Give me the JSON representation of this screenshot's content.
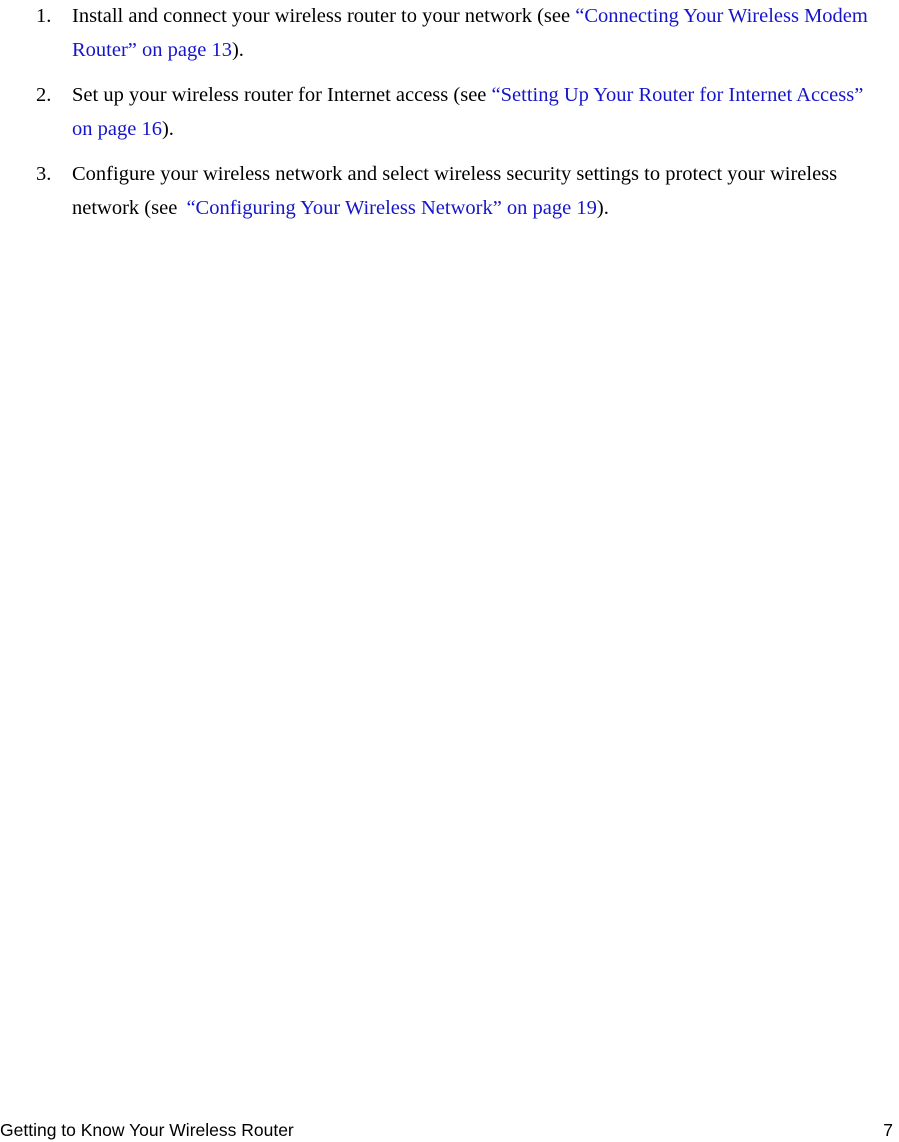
{
  "page": {
    "background_color": "#ffffff",
    "text_color": "#000000",
    "link_color": "#1515cc"
  },
  "content": {
    "list": [
      {
        "number": "1.",
        "lead": "Install and connect your wireless router to your network (see ",
        "xref": "“Connecting Your Wireless Modem Router” on page 13",
        "tail": ")."
      },
      {
        "number": "2.",
        "lead": "Set up your wireless router for Internet access (see ",
        "xref": "“Setting Up Your Router for Internet Access” on page 16",
        "tail": ")."
      },
      {
        "number": "3.",
        "lead": "Configure your wireless network and select wireless security settings to protect your wireless network (see ",
        "xref": "“Configuring Your Wireless Network” on page 19",
        "tail": ")."
      }
    ]
  },
  "footer": {
    "chapter_title": "Getting to Know Your Wireless Router",
    "page_number": "7"
  }
}
